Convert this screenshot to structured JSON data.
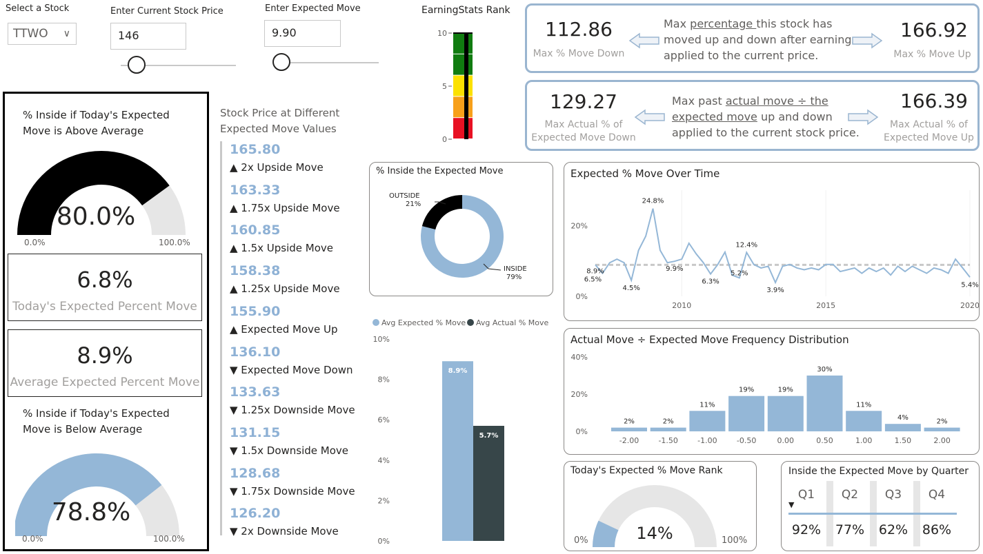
{
  "controls": {
    "stock_label": "Select a Stock",
    "stock_value": "TTWO",
    "price_label": "Enter Current Stock Price",
    "price_value": "146",
    "move_label": "Enter Expected Move",
    "move_value": "9.90"
  },
  "rank_meter": {
    "title": "EarningStats Rank",
    "ticks": [
      "10",
      "5",
      "0"
    ],
    "colors": [
      "#107c10",
      "#107c10",
      "#fce100",
      "#f7a01a",
      "#e81123"
    ]
  },
  "max_move": {
    "down_value": "112.86",
    "down_label": "Max % Move Down",
    "up_value": "166.92",
    "up_label": "Max % Move Up",
    "desc_1": "Max ",
    "desc_u": "percentage ",
    "desc_2": "this stock has",
    "desc_line2": "moved up and down after earnings",
    "desc_line3": "applied to the current price."
  },
  "actual_move": {
    "down_value": "129.27",
    "down_label_1": "Max Actual %  of",
    "down_label_2": "Expected Move Down",
    "up_value": "166.39",
    "up_label_1": "Max Actual %  of",
    "up_label_2": "Expected Move Up",
    "desc_1": "Max past ",
    "desc_u1": "actual move ÷ the ",
    "desc_u2": "expected move",
    "desc_2": " up and down",
    "desc_line3": "applied to the current stock price."
  },
  "left_panel": {
    "gauge1_title_1": "% Inside if Today's Expected",
    "gauge1_title_2": "Move is Above Average",
    "gauge1_value": "80.0%",
    "gauge1_min": "0.0%",
    "gauge1_max": "100.0%",
    "gauge1_fraction": 0.8,
    "kpi1_value": "6.8%",
    "kpi1_label": "Today's Expected Percent Move",
    "kpi2_value": "8.9%",
    "kpi2_label": "Average Expected Percent Move",
    "gauge2_title_1": "% Inside if Today's Expected",
    "gauge2_title_2": "Move is Below Average",
    "gauge2_value": "78.8%",
    "gauge2_min": "0.0%",
    "gauge2_max": "100.0%",
    "gauge2_fraction": 0.788
  },
  "price_list": {
    "title_1": "Stock Price at Different",
    "title_2": "Expected Move Values",
    "items": [
      {
        "price": "165.80",
        "label": "▲ 2x Upside Move"
      },
      {
        "price": "163.33",
        "label": "▲ 1.75x Upside Move"
      },
      {
        "price": "160.85",
        "label": "▲ 1.5x Upside Move"
      },
      {
        "price": "158.38",
        "label": "▲ 1.25x Upside Move"
      },
      {
        "price": "155.90",
        "label": "▲ Expected Move Up"
      },
      {
        "price": "136.10",
        "label": "▼ Expected Move Down"
      },
      {
        "price": "133.63",
        "label": "▼ 1.25x Downside Move"
      },
      {
        "price": "131.15",
        "label": "▼ 1.5x Downside Move"
      },
      {
        "price": "128.68",
        "label": "▼ 1.75x Downside Move"
      },
      {
        "price": "126.20",
        "label": "▼ 2x Downside Move"
      }
    ]
  },
  "donut": {
    "title": "% Inside the Expected Move",
    "outside_label": "OUTSIDE",
    "outside_pct": "21%",
    "inside_label": "INSIDE",
    "inside_pct": "79%"
  },
  "avg_bar": {
    "legend_1": "Avg Expected % Move",
    "legend_2": "Avg Actual % Move",
    "yticks": [
      "10%",
      "8%",
      "6%",
      "4%",
      "2%",
      "0%"
    ],
    "val_1_label": "8.9%",
    "val_2_label": "5.7%"
  },
  "line": {
    "title": "Expected % Move Over Time",
    "yticks": [
      "20%",
      "0%"
    ],
    "xticks": [
      "2010",
      "2015",
      "2020"
    ],
    "labels": [
      "24.8%",
      "12.4%",
      "8.9%",
      "6.5%",
      "4.5%",
      "9.9%",
      "6.3%",
      "5.2%",
      "3.9%",
      "5.4%"
    ]
  },
  "hist": {
    "title": "Actual Move ÷ Expected Move Frequency Distribution",
    "yticks": [
      "40%",
      "20%",
      "0%"
    ]
  },
  "rank_gauge": {
    "title": "Today's Expected % Move Rank",
    "value": "14%",
    "min": "0%",
    "max": "100%",
    "fraction": 0.14
  },
  "quarters": {
    "title": "Inside the Expected Move by Quarter",
    "items": [
      {
        "q": "Q1",
        "v": "92%"
      },
      {
        "q": "Q2",
        "v": "77%"
      },
      {
        "q": "Q3",
        "v": "62%"
      },
      {
        "q": "Q4",
        "v": "86%"
      }
    ]
  },
  "colors": {
    "blue": "#94b7d7",
    "dark": "#374649",
    "light": "#e6e6e6",
    "black": "#000000"
  },
  "chart_data": [
    {
      "type": "pie",
      "title": "% Inside the Expected Move",
      "categories": [
        "INSIDE",
        "OUTSIDE"
      ],
      "values": [
        79,
        21
      ]
    },
    {
      "type": "bar",
      "categories": [
        "Avg Expected % Move",
        "Avg Actual % Move"
      ],
      "values": [
        8.9,
        5.7
      ],
      "ylim": [
        0,
        10
      ]
    },
    {
      "type": "line",
      "title": "Expected % Move Over Time",
      "x": [
        2007.0,
        2007.25,
        2007.5,
        2007.75,
        2008.0,
        2008.25,
        2008.5,
        2008.75,
        2009.0,
        2009.25,
        2009.5,
        2009.75,
        2010.0,
        2010.25,
        2010.5,
        2010.75,
        2011.0,
        2011.25,
        2011.5,
        2011.75,
        2012.0,
        2012.25,
        2012.5,
        2012.75,
        2013.0,
        2013.25,
        2013.5,
        2013.75,
        2014.0,
        2014.25,
        2014.5,
        2014.75,
        2015.0,
        2015.25,
        2015.5,
        2015.75,
        2016.0,
        2016.25,
        2016.5,
        2016.75,
        2017.0,
        2017.25,
        2017.5,
        2017.75,
        2018.0,
        2018.25,
        2018.5,
        2018.75,
        2019.0,
        2019.25,
        2019.5,
        2019.75,
        2020.0
      ],
      "values": [
        8.9,
        6.5,
        9.5,
        10.5,
        9.5,
        4.5,
        13.0,
        17.0,
        24.8,
        13.0,
        9.5,
        9.9,
        10.5,
        15.0,
        12.0,
        9.5,
        6.3,
        9.0,
        12.5,
        6.0,
        5.2,
        12.4,
        9.0,
        8.0,
        8.5,
        3.9,
        8.5,
        9.0,
        8.0,
        7.5,
        8.0,
        7.5,
        9.0,
        9.0,
        7.0,
        7.5,
        8.0,
        6.5,
        8.0,
        7.0,
        8.0,
        6.0,
        8.5,
        7.0,
        8.5,
        7.5,
        6.5,
        8.0,
        7.5,
        6.5,
        10.5,
        8.0,
        5.4
      ],
      "average": 8.9,
      "ylim": [
        0,
        30
      ]
    },
    {
      "type": "bar",
      "title": "Actual Move ÷ Expected Move Frequency Distribution",
      "categories": [
        "-2.00",
        "-1.50",
        "-1.00",
        "-0.50",
        "0.00",
        "0.50",
        "1.00",
        "1.50",
        "2.00"
      ],
      "values": [
        2,
        2,
        11,
        19,
        19,
        30,
        11,
        4,
        2
      ],
      "value_labels": [
        "2%",
        "2%",
        "11%",
        "19%",
        "19%",
        "30%",
        "11%",
        "4%",
        "2%"
      ],
      "ylim": [
        0,
        40
      ]
    }
  ]
}
